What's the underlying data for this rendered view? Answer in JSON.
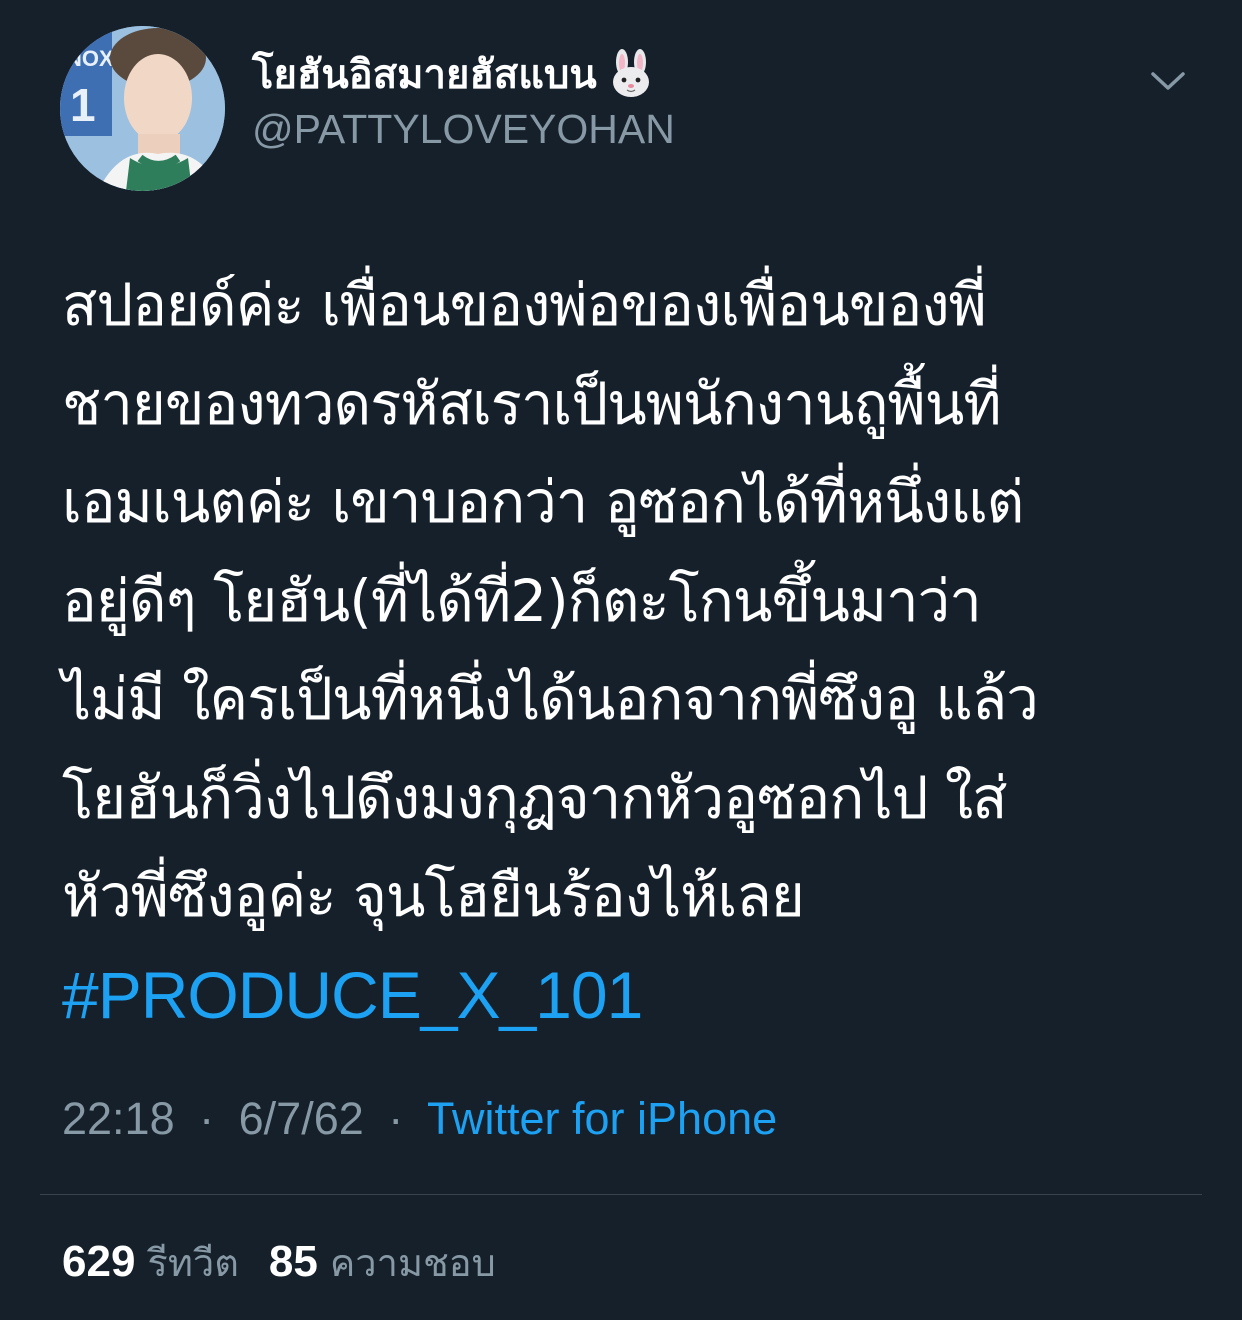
{
  "tweet": {
    "author": {
      "display_name": "โยฮันอิสมายฮัสแบน",
      "name_emoji_icon": "rabbit-face-icon",
      "handle": "@PATTYLOVEYOHAN"
    },
    "menu_icon": "chevron-down-icon",
    "body_lines": [
      "สปอยด์ค่ะ เพื่อนของพ่อของเพื่อนของพี่",
      "ชายของทวดรหัสเราเป็นพนักงานถูพื้นที่",
      "เอมเนตค่ะ เขาบอกว่า อูซอกได้ที่หนึ่งแต่",
      "อยู่ดีๆ โยฮัน(ที่ได้ที่2)ก็ตะโกนขึ้นมาว่า",
      "ไม่มี ใครเป็นที่หนึ่งได้นอกจากพี่ซึงอู แล้ว",
      "โยฮันก็วิ่งไปดึงมงกุฎจากหัวอูซอกไป ใส่",
      "หัวพี่ซึงอูค่ะ จุนโฮยืนร้องไห้เลย"
    ],
    "hashtag": "#PRODUCE_X_101",
    "time": "22:18",
    "date": "6/7/62",
    "separator": "·",
    "source": "Twitter for iPhone",
    "retweets_count": "629",
    "retweets_label": "รีทวีต",
    "likes_count": "85",
    "likes_label": "ความชอบ"
  },
  "colors": {
    "background": "#15202b",
    "text_primary": "#ffffff",
    "text_secondary": "#8899a6",
    "accent": "#1da1f2",
    "divider": "#38444d"
  }
}
